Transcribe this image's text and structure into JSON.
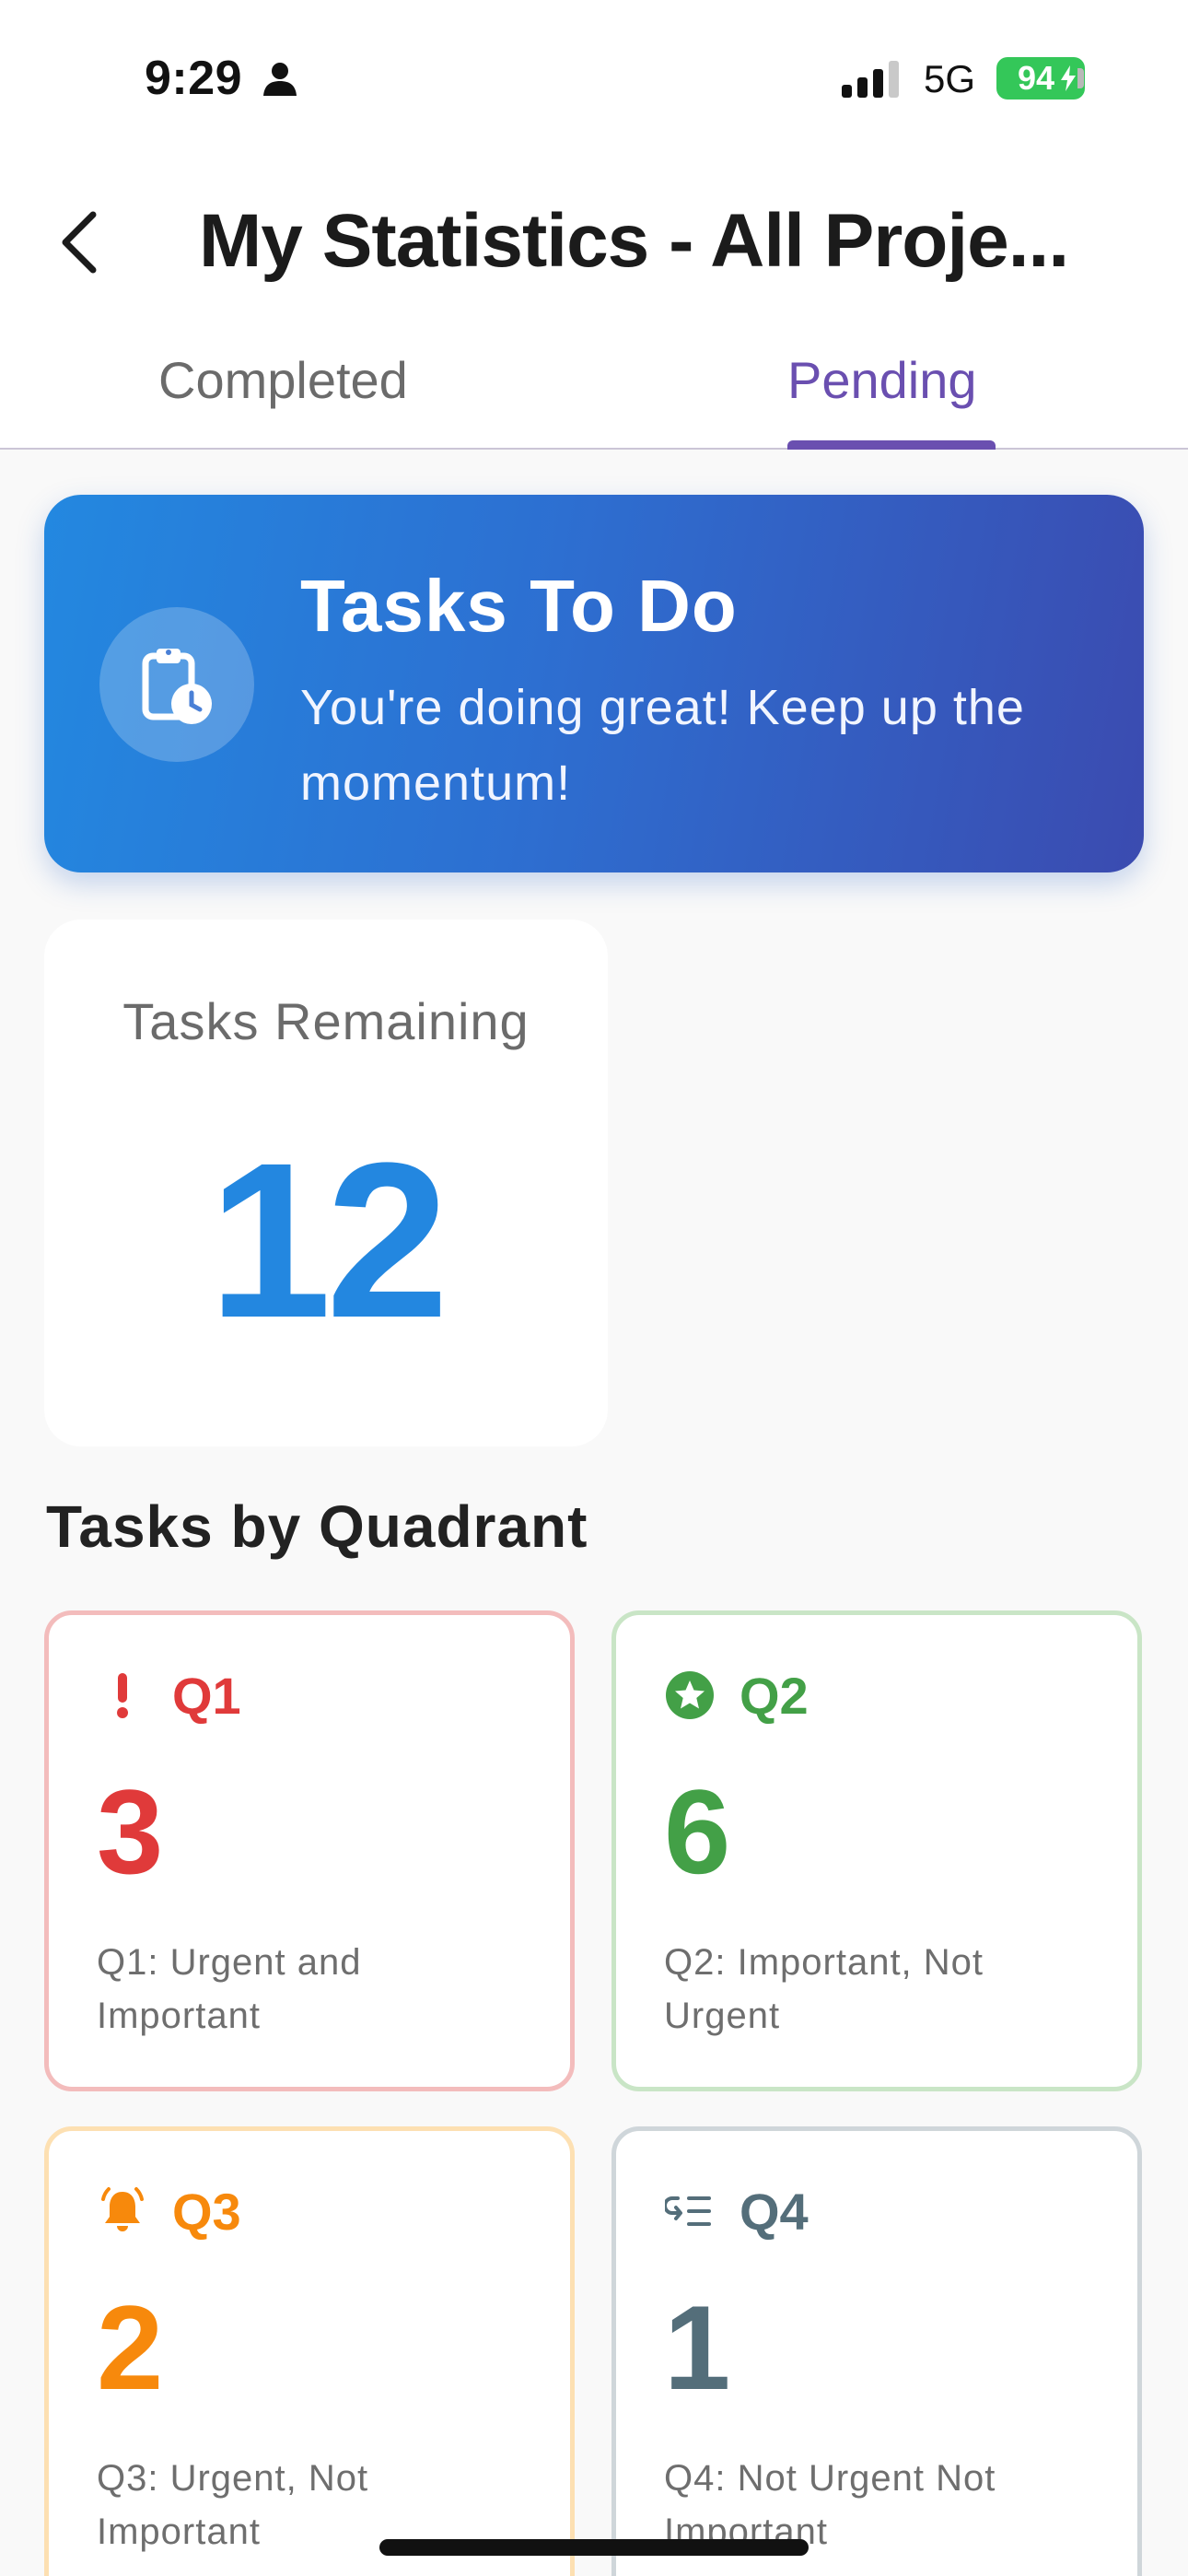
{
  "status_bar": {
    "time": "9:29",
    "network": "5G",
    "battery": "94"
  },
  "header": {
    "title": "My Statistics - All Proje..."
  },
  "tabs": [
    {
      "label": "Completed",
      "active": false
    },
    {
      "label": "Pending",
      "active": true
    }
  ],
  "hero": {
    "title": "Tasks To Do",
    "subtitle": "You're doing great! Keep up the momentum!",
    "icon": "clipboard-clock-icon"
  },
  "remaining": {
    "label": "Tasks Remaining",
    "value": "12"
  },
  "section": {
    "title": "Tasks by Quadrant"
  },
  "quadrants": [
    {
      "name": "Q1",
      "count": "3",
      "description": "Q1: Urgent and Important",
      "color": "#e03a3a",
      "icon": "exclamation-icon"
    },
    {
      "name": "Q2",
      "count": "6",
      "description": "Q2: Important, Not Urgent",
      "color": "#43a047",
      "icon": "star-circle-icon"
    },
    {
      "name": "Q3",
      "count": "2",
      "description": "Q3: Urgent, Not Important",
      "color": "#f7890c",
      "icon": "bell-icon"
    },
    {
      "name": "Q4",
      "count": "1",
      "description": "Q4: Not Urgent Not Important",
      "color": "#546e7a",
      "icon": "list-return-icon"
    }
  ]
}
